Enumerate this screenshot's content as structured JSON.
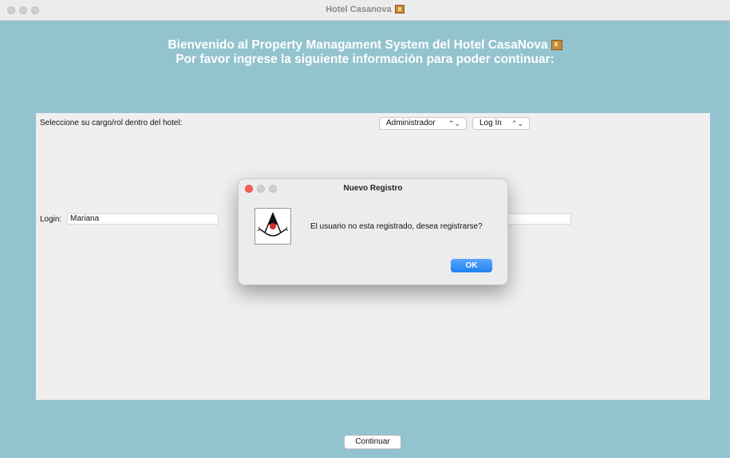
{
  "window": {
    "title": "Hotel Casanova"
  },
  "header": {
    "line1": "Bienvenido al Property Managament System del Hotel CasaNova",
    "line2": "Por favor ingrese la siguiente información para poder continuar:"
  },
  "form": {
    "role_label": "Seleccione su cargo/rol dentro del hotel:",
    "role_value": "Administrador",
    "action_value": "Log In",
    "login_label": "Login:",
    "login_value": "Mariana",
    "password_value": ""
  },
  "dialog": {
    "title": "Nuevo Registro",
    "message": "El usuario no esta registrado, desea registrarse?",
    "ok_label": "OK"
  },
  "footer": {
    "continue_label": "Continuar"
  },
  "icons": {
    "hotel": "hotel-icon",
    "duke": "java-duke-icon"
  },
  "colors": {
    "background": "#93c3cf",
    "accent": "#1f7ff0"
  }
}
